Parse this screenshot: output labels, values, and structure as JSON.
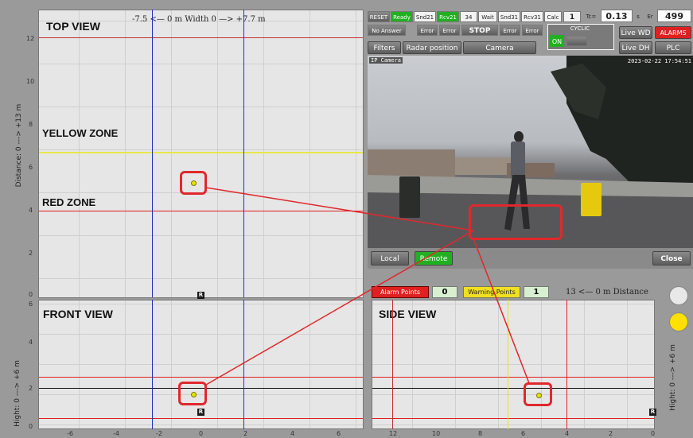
{
  "top_view": {
    "title": "TOP VIEW",
    "width_label": "-7.5 <— 0 m Width 0 —> +7.7 m",
    "y_axis_label": "Distance: 0 ---> +13 m",
    "y_ticks": [
      "12",
      "10",
      "8",
      "6",
      "4",
      "2",
      "0"
    ],
    "yellow_zone": "YELLOW ZONE",
    "red_zone": "RED ZONE",
    "marker": "R"
  },
  "front_view": {
    "title": "FRONT VIEW",
    "y_axis_label": "Hight: 0 ---> +6 m",
    "y_ticks": [
      "6",
      "4",
      "2",
      "0"
    ],
    "x_ticks": [
      "-6",
      "-4",
      "-2",
      "0",
      "2",
      "4",
      "6"
    ],
    "marker": "R"
  },
  "side_view": {
    "title": "SIDE VIEW",
    "y_axis_label": "Hight: 0 ---> +6 m",
    "x_ticks": [
      "12",
      "10",
      "8",
      "6",
      "4",
      "2",
      "0"
    ],
    "distance_label": "13 <— 0 m Distance",
    "marker": "R"
  },
  "toolbar": {
    "reset": "RESET",
    "ready": "Ready",
    "snd21": "Snd21",
    "rcv21": "Rcv21",
    "count34": "34",
    "wait": "Wait",
    "snd31": "Snd31",
    "rcv31": "Rcv31",
    "calc": "Calc",
    "calc_value": "1",
    "tc_label": "Tc=",
    "tc_value": "0.13",
    "tc_unit": "s",
    "er_label": "Er",
    "er_value": "499",
    "no_answer": "No Answer",
    "error1": "Error",
    "error2": "Error",
    "stop": "STOP",
    "error3": "Error",
    "error4": "Error",
    "cyclic": "CYCLIC",
    "cyclic_on": "ON",
    "live_wd": "Live WD",
    "alarms": "ALARMS",
    "filters": "Filters",
    "radar_position": "Radar position",
    "camera": "Camera",
    "live_dh": "Live DH",
    "plc": "PLC"
  },
  "camera_view": {
    "label": "IP Camera",
    "timestamp": "2023-02-22 17:54:51"
  },
  "camera_controls": {
    "local": "Local",
    "remote": "Remote",
    "close": "Close"
  },
  "points": {
    "alarm_label": "Alarm Points",
    "alarm_count": "0",
    "warning_label": "Warning Points",
    "warning_count": "1"
  },
  "colors": {
    "alarm": "#e02020",
    "warning": "#f0e020",
    "active_green": "#22b022",
    "indicator_off": "#e8e8e8",
    "indicator_warn": "#ffe000"
  }
}
